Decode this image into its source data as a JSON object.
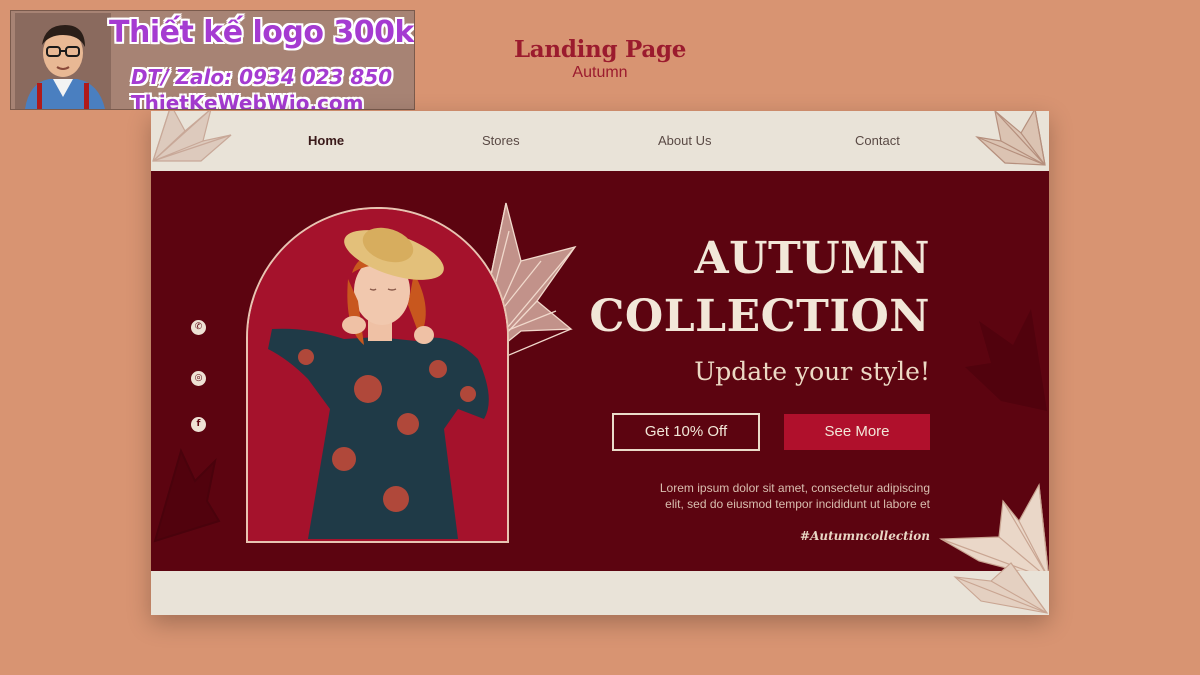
{
  "ad": {
    "line1": "Thiết kế logo 300k",
    "line2": "DT/ Zalo: 0934 023 850",
    "line3": "ThietKeWebWio.com"
  },
  "heading": {
    "title": "Landing Page",
    "subtitle": "Autumn"
  },
  "nav": {
    "items": [
      {
        "label": "Home",
        "active": true
      },
      {
        "label": "Stores",
        "active": false
      },
      {
        "label": "About Us",
        "active": false
      },
      {
        "label": "Contact",
        "active": false
      }
    ]
  },
  "hero": {
    "title_line1": "AUTUMN",
    "title_line2": "COLLECTION",
    "subtitle": "Update your style!",
    "primary_button": "Get 10% Off",
    "secondary_button": "See More",
    "description_line1": "Lorem ipsum dolor sit amet, consectetur adipiscing",
    "description_line2": "elit, sed do eiusmod tempor incididunt ut labore et",
    "hashtag": "#Autumncollection"
  },
  "social_icons": [
    "whatsapp-icon",
    "instagram-icon",
    "facebook-icon"
  ],
  "colors": {
    "page_bg": "#d89472",
    "hero_bg": "#5c0410",
    "accent": "#b0102c",
    "cream": "#e9e3d8",
    "heading": "#9b1b2e"
  }
}
